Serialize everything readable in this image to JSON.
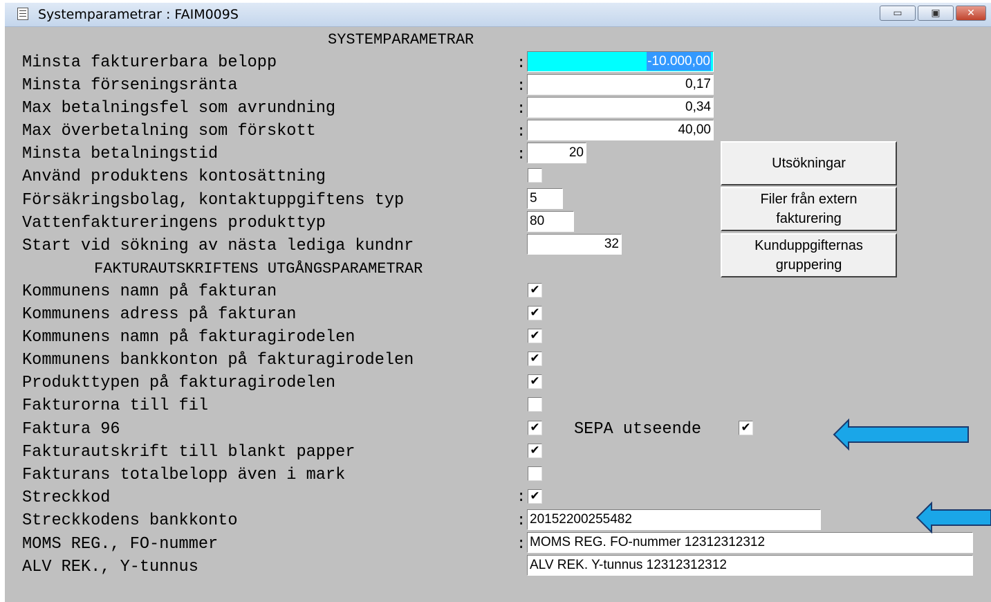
{
  "window": {
    "title": "Systemparametrar : FAIM009S",
    "controls": {
      "minimize": "▭",
      "maximize": "▣",
      "close": "✕"
    }
  },
  "sections": {
    "system": "SYSTEMPARAMETRAR",
    "invoice_print": "FAKTURAUTSKRIFTENS UTGÅNGSPARAMETRAR"
  },
  "colon": ":",
  "fields": {
    "min_billable": {
      "label": "Minsta fakturerbara belopp",
      "value": "-10.000,00"
    },
    "min_late_interest": {
      "label": "Minsta förseningsränta",
      "value": "0,17"
    },
    "max_payment_error": {
      "label": "Max betalningsfel som avrundning",
      "value": "0,34"
    },
    "max_overpayment": {
      "label": "Max överbetalning som förskott",
      "value": "40,00"
    },
    "min_payment_time": {
      "label": "Minsta betalningstid",
      "value": "20"
    },
    "use_product_accounts": {
      "label": "Använd produktens kontosättning",
      "checked": false
    },
    "insurance_contact_type": {
      "label": "Försäkringsbolag, kontaktuppgiftens typ",
      "value": "5"
    },
    "water_product_type": {
      "label": "Vattenfaktureringens produkttyp",
      "value": "80"
    },
    "next_customer_start": {
      "label": "Start vid sökning av nästa lediga kundnr",
      "value": "32"
    },
    "municipality_name": {
      "label": "Kommunens namn på fakturan",
      "checked": true
    },
    "municipality_address": {
      "label": "Kommunens adress på fakturan",
      "checked": true
    },
    "municipality_name_giro": {
      "label": "Kommunens namn på fakturagirodelen",
      "checked": true
    },
    "municipality_bank_giro": {
      "label": "Kommunens bankkonton på fakturagirodelen",
      "checked": true
    },
    "product_type_giro": {
      "label": "Produkttypen på fakturagirodelen",
      "checked": true
    },
    "invoices_to_file": {
      "label": "Fakturorna till fil",
      "checked": false
    },
    "faktura96": {
      "label": "Faktura 96",
      "checked": true
    },
    "sepa": {
      "label": "SEPA utseende",
      "checked": true
    },
    "blank_paper": {
      "label": "Fakturautskrift till blankt papper",
      "checked": true
    },
    "total_in_mark": {
      "label": "Fakturans totalbelopp även i mark",
      "checked": false
    },
    "barcode": {
      "label": "Streckkod",
      "checked": true
    },
    "barcode_bank_account": {
      "label": "Streckkodens bankkonto",
      "value": "20152200255482"
    },
    "vat_reg": {
      "label": "MOMS REG., FO-nummer",
      "value": "MOMS REG. FO-nummer 12312312312"
    },
    "alv_rek": {
      "label": "ALV REK., Y-tunnus",
      "value": "ALV REK.  Y-tunnus 12312312312"
    }
  },
  "buttons": {
    "collections": "Utsökningar",
    "external_files": "Filer från extern fakturering",
    "customer_grouping": "Kunduppgifternas gruppering"
  },
  "check_glyph": "✔",
  "arrow_color": "#1aa6e8"
}
